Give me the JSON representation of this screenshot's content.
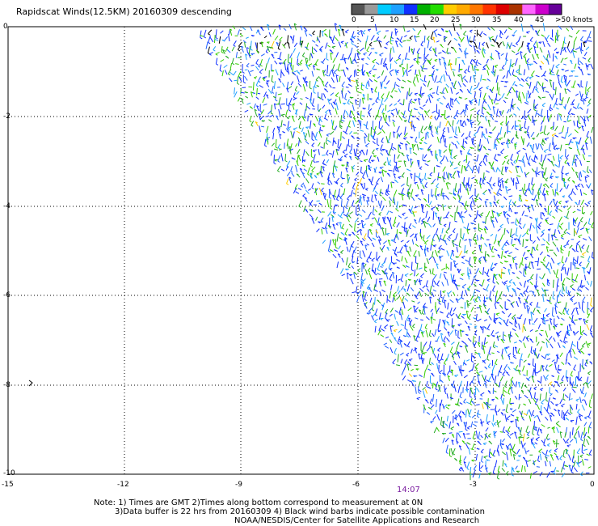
{
  "title": "Rapidscat Winds(12.5KM) 20160309 descending",
  "legend": {
    "labels": [
      "0",
      "5",
      "10",
      "15",
      "20",
      "25",
      "30",
      "35",
      "40",
      "45",
      ">50 knots"
    ],
    "colors": [
      "#555555",
      "#9a9a9a",
      "#00ccff",
      "#1ea0ff",
      "#1030ff",
      "#00b000",
      "#22dd00",
      "#ffcc00",
      "#ffaa00",
      "#ff7700",
      "#ff3300",
      "#dd0000",
      "#aa3300",
      "#ff66ff",
      "#cc00cc",
      "#660099"
    ]
  },
  "axes": {
    "y_labels": [
      "0",
      "-2",
      "-4",
      "-6",
      "-8",
      "-10"
    ],
    "x_labels": [
      "-15",
      "-12",
      "-9",
      "-6",
      "-3",
      "0"
    ]
  },
  "pass_time": "14:07",
  "notes": [
    "Note: 1) Times are GMT 2)Times along bottom correspond to measurement at 0N",
    "3)Data buffer is 22 hrs from 20160309 4) Black wind barbs indicate possible contamination",
    "NOAA/NESDIS/Center for Satellite Applications and Research"
  ]
}
